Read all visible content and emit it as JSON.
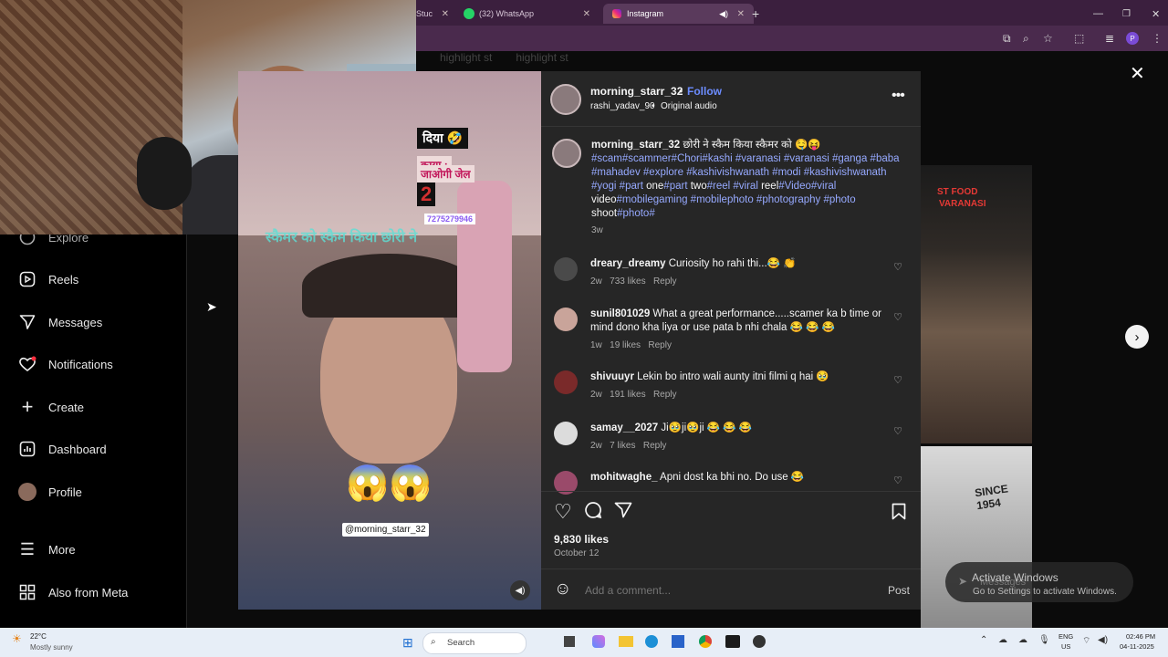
{
  "browser": {
    "tabs": [
      {
        "label": "Stuc"
      },
      {
        "label": "(32) WhatsApp"
      },
      {
        "label": "Instagram"
      }
    ],
    "profile_initial": "P",
    "highlights": [
      "highlight st",
      "highlight st"
    ]
  },
  "sidebar": {
    "items": [
      {
        "label": "Explore",
        "icon": "compass-icon"
      },
      {
        "label": "Reels",
        "icon": "reels-icon"
      },
      {
        "label": "Messages",
        "icon": "messages-icon"
      },
      {
        "label": "Notifications",
        "icon": "heart-icon"
      },
      {
        "label": "Create",
        "icon": "plus-icon"
      },
      {
        "label": "Dashboard",
        "icon": "dashboard-icon"
      },
      {
        "label": "Profile",
        "icon": "avatar"
      },
      {
        "label": "More",
        "icon": "menu-icon"
      },
      {
        "label": "Also from Meta",
        "icon": "meta-grid-icon"
      }
    ]
  },
  "video": {
    "overlay_text_1": "दिया 🤣",
    "overlay_text_2": "काया :",
    "overlay_text_3": "जाओगी जेल",
    "overlay_number": "2",
    "overlay_phone": "7275279946",
    "overlay_caption": "स्कैमर को स्कैम किया छोरी ने",
    "emoji": "😱😱",
    "handle_tag": "@morning_starr_32"
  },
  "post": {
    "username": "morning_starr_32",
    "follow_label": "Follow",
    "audio_user": "rashi_yadav_90",
    "audio_label": "Original audio",
    "caption_user": "morning_starr_32",
    "caption_text": "छोरी ने स्कैम किया स्कैमर को 🤤😝",
    "hashtags_1": "#scam#scammer#Chori#kashi #varanasi #varanasi #ganga #baba",
    "hashtags_2": "#mahadev #explore #kashivishwanath #modi #kashivishwanath",
    "line3_a": "#yogi #part",
    "line3_b": "one",
    "line3_c": "#part",
    "line3_d": "two",
    "line3_e": "#reel #viral",
    "line3_f": "reel",
    "line3_g": "#Video#viral",
    "line4_a": "video",
    "line4_b": "#mobilegaming #mobilephoto #photography #photo",
    "line5_a": "shoot",
    "line5_b": "#photo#",
    "caption_age": "3w",
    "likes": "9,830 likes",
    "date": "October 12",
    "comment_placeholder": "Add a comment...",
    "post_button": "Post"
  },
  "comments": [
    {
      "user": "dreary_dreamy",
      "text": "Curiosity ho rahi thi...😂 👏",
      "age": "2w",
      "likes": "733 likes",
      "reply": "Reply"
    },
    {
      "user": "sunil801029",
      "text": "What a great performance.....scamer ka b time or mind dono kha liya or use pata b nhi chala 😂 😂 😂",
      "age": "1w",
      "likes": "19 likes",
      "reply": "Reply"
    },
    {
      "user": "shivuuyr",
      "text": "Lekin bo intro wali aunty itni filmi q hai 🥹",
      "age": "2w",
      "likes": "191 likes",
      "reply": "Reply"
    },
    {
      "user": "samay__2027",
      "text": "Ji🥹ji🥹ji 😂 😂 😂",
      "age": "2w",
      "likes": "7 likes",
      "reply": "Reply"
    },
    {
      "user": "mohitwaghe_",
      "text": "Apni dost ka bhi no. Do use 😂",
      "age": "",
      "likes": "",
      "reply": ""
    }
  ],
  "preview": {
    "title_1": "ST FOOD",
    "title_2": "VARANASI",
    "since": "SINCE 1954"
  },
  "overlay": {
    "activate_title": "Activate Windows",
    "activate_sub": "Go to Settings to activate Windows.",
    "messages_label": "Messages"
  },
  "taskbar": {
    "weather_temp": "22°C",
    "weather_desc": "Mostly sunny",
    "search_placeholder": "Search",
    "lang_1": "ENG",
    "lang_2": "US",
    "time": "02:46 PM",
    "date": "04-11-2025"
  }
}
